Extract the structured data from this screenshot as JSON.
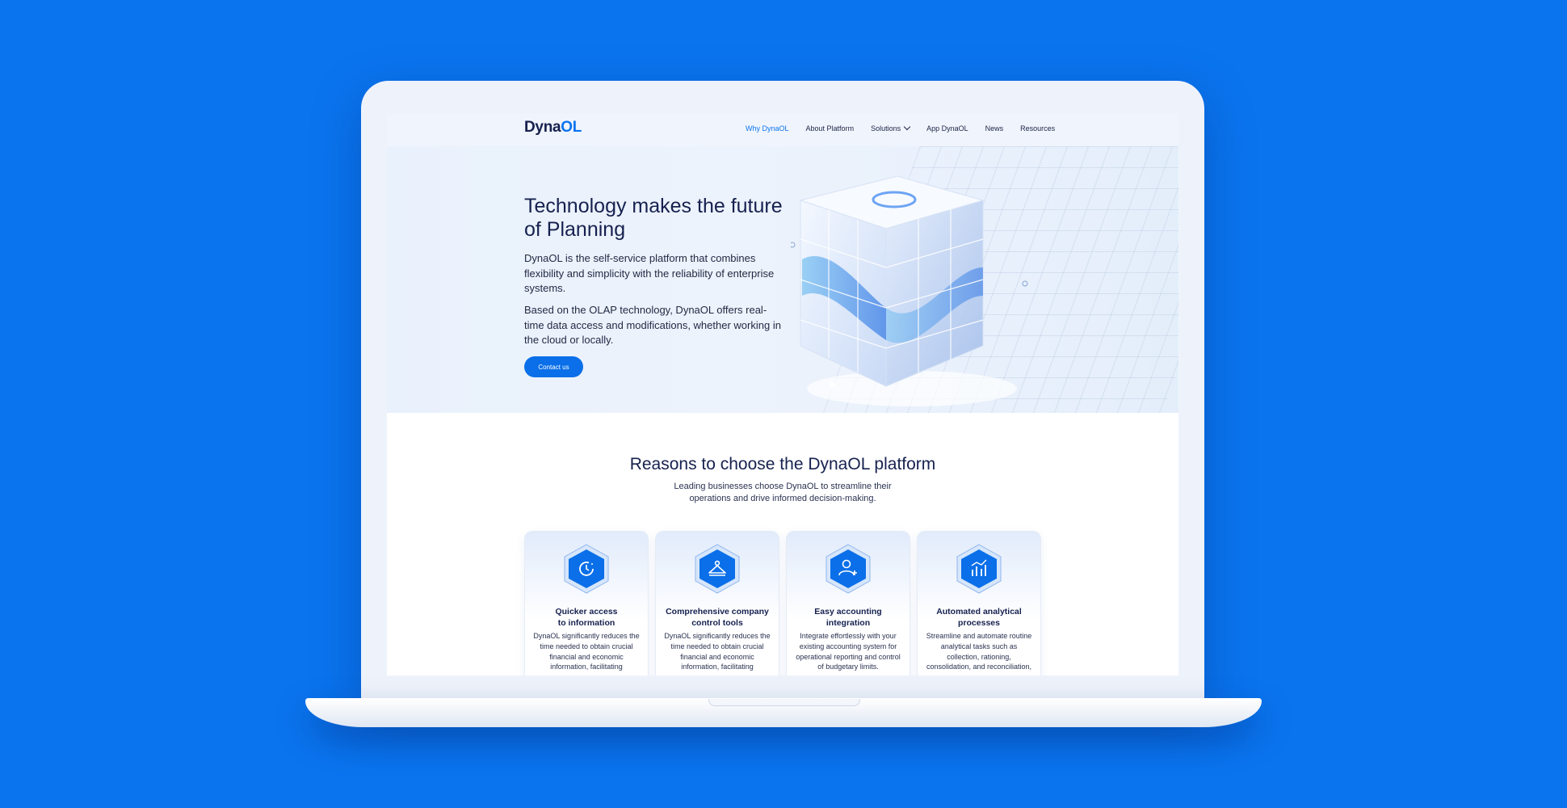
{
  "header": {
    "logo_main": "Dyna",
    "logo_accent": "OL",
    "nav": [
      "Why DynaOL",
      "About Platform",
      "Solutions",
      "App DynaOL",
      "News",
      "Resources"
    ]
  },
  "hero": {
    "title": "Technology makes the future of Planning",
    "paragraph1": "DynaOL is the self-service platform that combines flexibility and simplicity with the reliability of enterprise systems.",
    "paragraph2": "Based on the OLAP technology, DynaOL offers real-time data access and modifications, whether working in the cloud or locally.",
    "cta_label": "Contact us"
  },
  "reasons": {
    "title": "Reasons to choose the DynaOL platform",
    "subtitle": "Leading businesses choose DynaOL to streamline their operations and drive informed decision-making.",
    "cards": [
      {
        "icon": "clock-refresh-icon",
        "title": "Quicker access\nto information",
        "text": "DynaOL significantly reduces the time needed to obtain crucial financial and economic information, facilitating"
      },
      {
        "icon": "hanger-tools-icon",
        "title": "Comprehensive company\ncontrol tools",
        "text": "DynaOL significantly reduces the time needed to obtain crucial financial and economic information, facilitating"
      },
      {
        "icon": "user-add-icon",
        "title": "Easy accounting\nintegration",
        "text": "Integrate effortlessly with your existing accounting system for operational reporting and control of budgetary limits."
      },
      {
        "icon": "analytics-chart-icon",
        "title": "Automated analytical\nprocesses",
        "text": "Streamline and automate routine analytical tasks such as collection, rationing, consolidation, and reconciliation,"
      }
    ]
  },
  "colors": {
    "background": "#0a74ee",
    "accent": "#0a74ee",
    "heading": "#16214f"
  }
}
